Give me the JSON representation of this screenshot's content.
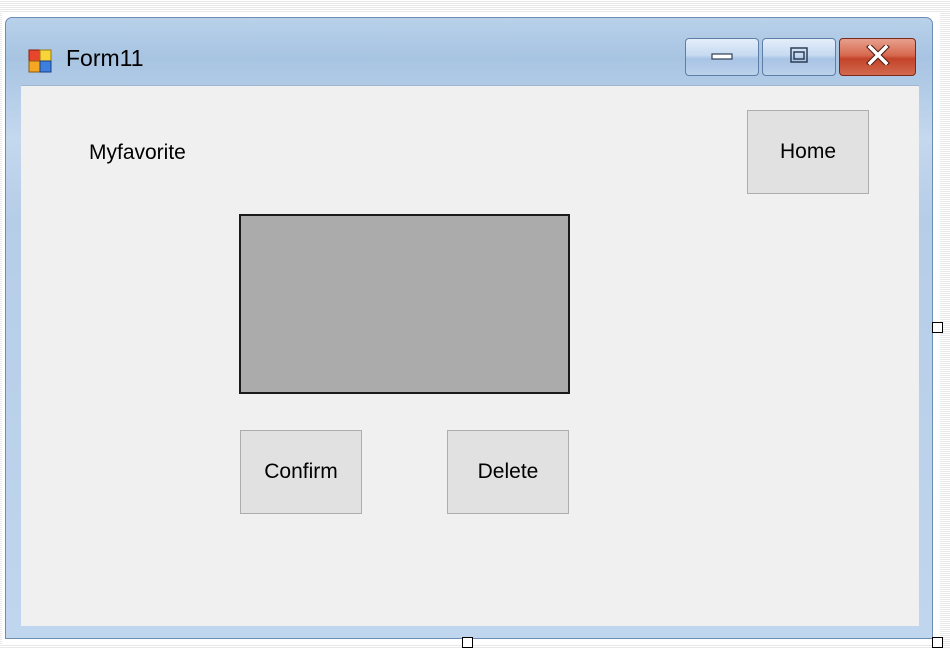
{
  "window": {
    "title": "Form11",
    "icon": "winforms-app-icon"
  },
  "caption_buttons": {
    "minimize_icon": "minimize-icon",
    "maximize_icon": "maximize-icon",
    "close_icon": "close-icon"
  },
  "form": {
    "label_text": "Myfavorite",
    "home_label": "Home",
    "confirm_label": "Confirm",
    "delete_label": "Delete"
  },
  "colors": {
    "client_background": "#f0f0f0",
    "picture_box_fill": "#ababab",
    "button_face": "#e1e1e1",
    "close_button": "#c3432a"
  }
}
